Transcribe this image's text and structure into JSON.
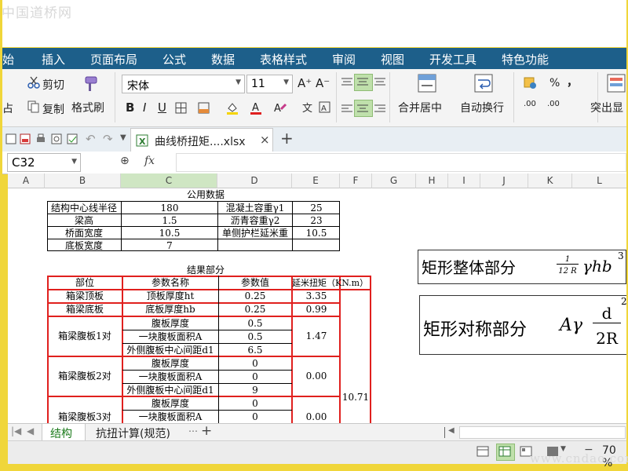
{
  "watermark_top": "中国道桥网",
  "watermark_bottom": "www.cndao.com",
  "menu": [
    "始",
    "插入",
    "页面布局",
    "公式",
    "数据",
    "表格样式",
    "审阅",
    "视图",
    "开发工具",
    "特色功能"
  ],
  "ribbon": {
    "cut": "剪切",
    "copy": "复制",
    "format_painter": "格式刷",
    "paste_fragment": "占",
    "font_name": "宋体",
    "font_size": "11",
    "bold": "B",
    "italic": "I",
    "underline": "U",
    "font_grow": "A⁺",
    "font_shrink": "A⁻",
    "merge_center": "合并居中",
    "wrap_text": "自动换行",
    "percent": "%",
    "comma": "，",
    "dec_inc": ".00",
    "dec_dec": ".00",
    "highlight": "突出显"
  },
  "file_tab": "曲线桥扭矩....xlsx",
  "name_box": "C32",
  "fx": "fx",
  "columns": [
    "A",
    "B",
    "C",
    "D",
    "E",
    "F",
    "G",
    "H",
    "I",
    "J",
    "K",
    "L"
  ],
  "public_title": "公用数据",
  "public_rows": [
    [
      "结构中心线半径",
      "180",
      "混凝土容重γ1",
      "25"
    ],
    [
      "梁高",
      "1.5",
      "沥青容重γ2",
      "23"
    ],
    [
      "桥面宽度",
      "10.5",
      "单侧护栏延米重",
      "10.5"
    ],
    [
      "底板宽度",
      "7",
      "",
      ""
    ]
  ],
  "result_title": "结果部分",
  "result_header": [
    "部位",
    "参数名称",
    "参数值",
    "延米扭矩（KN.m）"
  ],
  "result_rows": {
    "top": [
      "箱梁顶板",
      "顶板厚度ht",
      "0.25",
      "3.35"
    ],
    "bottom": [
      "箱梁底板",
      "底板厚度hb",
      "0.25",
      "0.99"
    ],
    "web1": {
      "label": "箱梁腹板1对",
      "params": [
        "腹板厚度",
        "一块腹板面积A",
        "外侧腹板中心间距d1"
      ],
      "values": [
        "0.5",
        "0.5",
        "6.5"
      ],
      "torque": "1.47"
    },
    "web2": {
      "label": "箱梁腹板2对",
      "params": [
        "腹板厚度",
        "一块腹板面积A",
        "外侧腹板中心间距d1"
      ],
      "values": [
        "0",
        "0",
        "9"
      ],
      "torque": "0.00"
    },
    "web3": {
      "label": "箱梁腹板3对",
      "params": [
        "腹板厚度",
        "一块腹板面积A"
      ],
      "values": [
        "0",
        "0"
      ],
      "torque": "0.00"
    },
    "total": "10.71"
  },
  "formula_box1": {
    "label": "矩形整体部分",
    "frac_num": "1",
    "frac_den": "12 R",
    "expr": "γhb",
    "sup": "3"
  },
  "formula_box2": {
    "label": "矩形对称部分",
    "prefix": "Aγ",
    "frac_num": "d",
    "frac_den": "2R",
    "sup": "2"
  },
  "sheets": [
    "结构",
    "抗扭计算(规范)"
  ],
  "zoom": "70 %"
}
